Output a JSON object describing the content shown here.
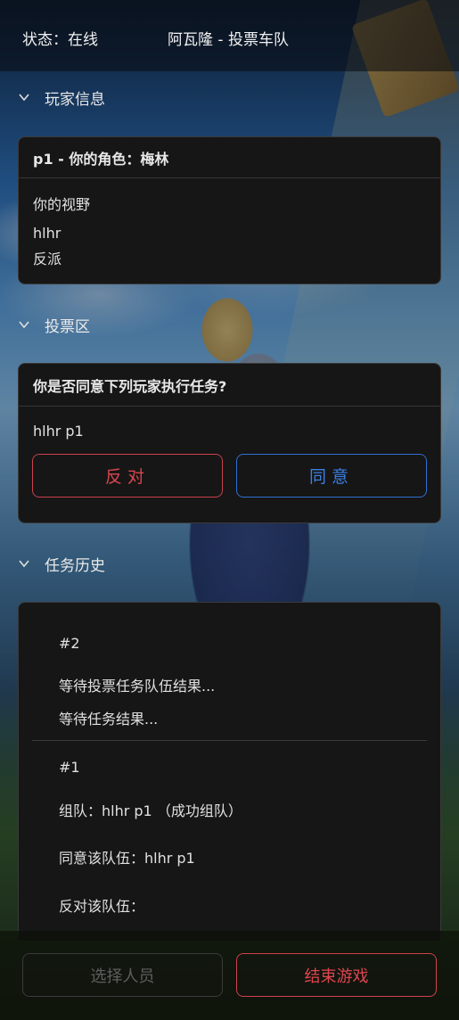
{
  "header": {
    "status": "状态：在线",
    "title": "阿瓦隆 - 投票车队"
  },
  "player_info": {
    "section_title": "玩家信息",
    "card_title": "p1 - 你的角色：梅林",
    "vision_label": "你的视野",
    "vision_player": "hlhr",
    "vision_faction": "反派"
  },
  "vote": {
    "section_title": "投票区",
    "question": "你是否同意下列玩家执行任务?",
    "players": "hlhr  p1",
    "oppose_label": "反对",
    "agree_label": "同意"
  },
  "history": {
    "section_title": "任务历史",
    "entries": [
      {
        "number": "#2",
        "line1": "等待投票任务队伍结果...",
        "line2": "等待任务结果..."
      },
      {
        "number": "#1",
        "team": "组队：hlhr  p1 （成功组队）",
        "agree": "同意该队伍：hlhr  p1",
        "oppose": "反对该队伍："
      }
    ]
  },
  "footer": {
    "select_label": "选择人员",
    "end_label": "结束游戏"
  },
  "colors": {
    "danger": "#d9464f",
    "primary": "#3a7fe6",
    "card_bg": "#161616"
  }
}
